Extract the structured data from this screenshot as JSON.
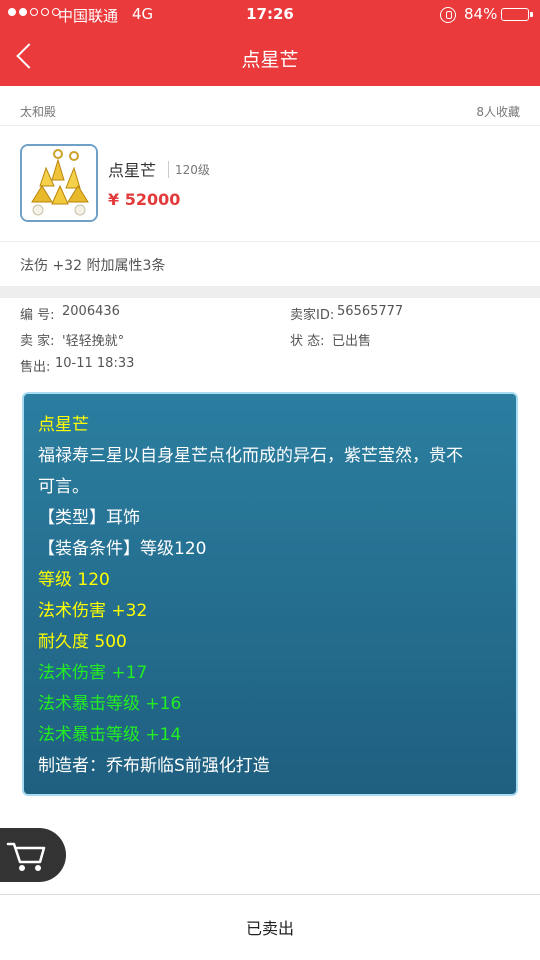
{
  "status_bar": {
    "carrier": "中国联通",
    "network": "4G",
    "time": "17:26",
    "battery": "84%",
    "battery_level": 0.84,
    "signal_bars": 2
  },
  "nav": {
    "title": "点星芒"
  },
  "shop": {
    "name": "太和殿",
    "favorites": "8人收藏"
  },
  "item": {
    "name": "点星芒",
    "level": "120级",
    "price": "¥ 52000",
    "thumb_icon": "gold-earring-icon"
  },
  "attributes": "法伤 +32  附加属性3条",
  "meta": {
    "serial_label": "编  号:",
    "serial": "2006436",
    "seller_id_label": "卖家ID:",
    "seller_id": "56565777",
    "seller_label": "卖  家:",
    "seller": "'轻轻挽就°",
    "status_label": "状  态:",
    "status": "已出售",
    "sold_label": "售出:",
    "sold_time": "10-11 18:33"
  },
  "description": {
    "title": "点星芒",
    "lines": [
      {
        "text": "福禄寿三星以自身星芒点化而成的异石，紫芒莹然，贵不",
        "color": "#ffffff"
      },
      {
        "text": "可言。",
        "color": "#ffffff"
      },
      {
        "text": "【类型】耳饰",
        "color": "#ffffff"
      },
      {
        "text": "【装备条件】等级120",
        "color": "#ffffff"
      },
      {
        "text": "等级 120",
        "color": "#ffff00"
      },
      {
        "text": "法术伤害 +32",
        "color": "#ffff00"
      },
      {
        "text": "耐久度 500",
        "color": "#ffff00"
      },
      {
        "text": "法术伤害 +17",
        "color": "#22ee22"
      },
      {
        "text": "法术暴击等级 +16",
        "color": "#22ee22"
      },
      {
        "text": "法术暴击等级 +14",
        "color": "#22ee22"
      },
      {
        "text": "制造者：乔布斯临S前强化打造",
        "color": "#ffffff"
      }
    ]
  },
  "bottom": {
    "sold_label": "已卖出"
  },
  "colors": {
    "header": "#ea3a3c",
    "price": "#e33b3b",
    "desc_bg": "#2b7ea0"
  }
}
